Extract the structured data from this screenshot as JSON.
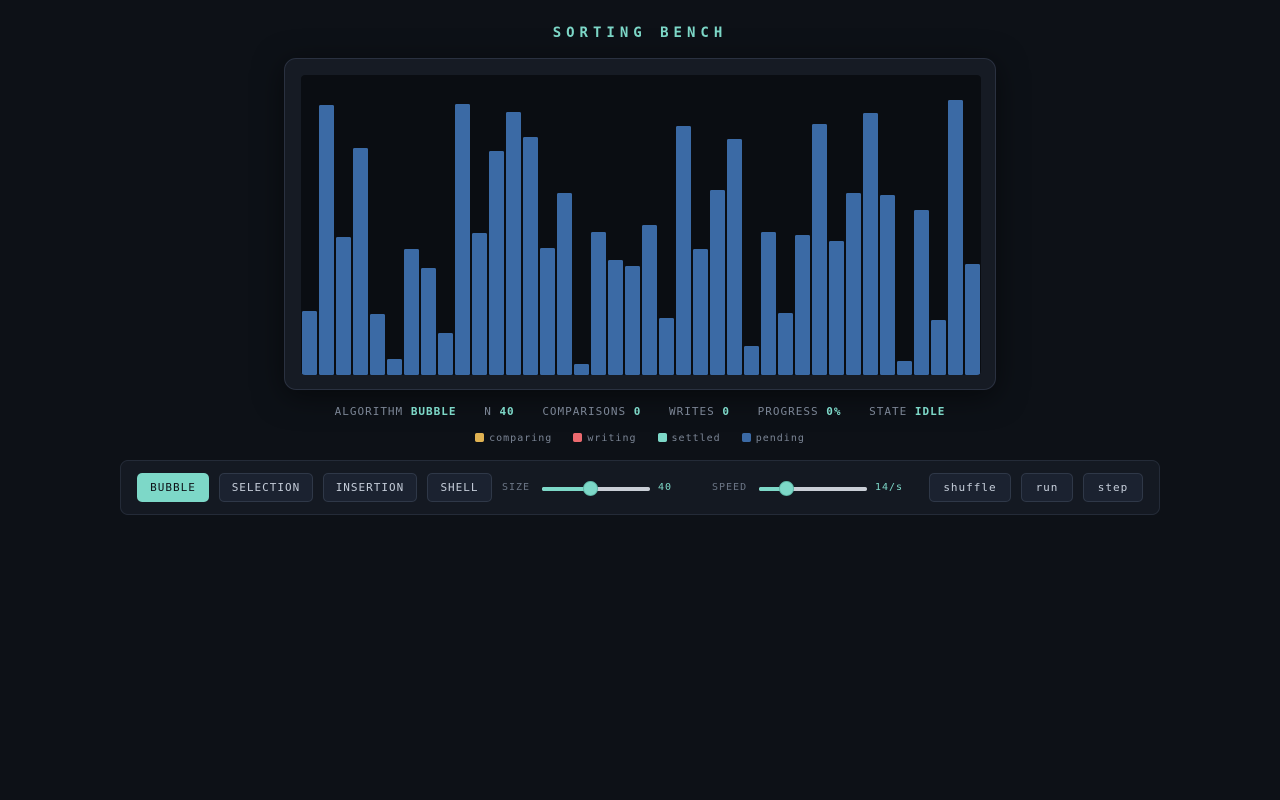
{
  "title": "SORTING BENCH",
  "stats": [
    {
      "label": "ALGORITHM",
      "value": "BUBBLE"
    },
    {
      "label": "N",
      "value": "40"
    },
    {
      "label": "COMPARISONS",
      "value": "0"
    },
    {
      "label": "WRITES",
      "value": "0"
    },
    {
      "label": "PROGRESS",
      "value": "0%"
    },
    {
      "label": "STATE",
      "value": "IDLE"
    }
  ],
  "legend": [
    {
      "label": "comparing",
      "color": "#e0b252"
    },
    {
      "label": "writing",
      "color": "#ec6a6f"
    },
    {
      "label": "settled",
      "color": "#7dd8c8"
    },
    {
      "label": "pending",
      "color": "#3b6aa5"
    }
  ],
  "array_values": [
    64,
    270,
    138,
    227,
    61,
    16,
    126,
    107,
    42,
    271,
    142,
    224,
    263,
    238,
    127,
    182,
    11,
    143,
    115,
    109,
    150,
    57,
    249,
    126,
    185,
    236,
    29,
    143,
    62,
    140,
    251,
    134,
    182,
    262,
    180,
    14,
    165,
    55,
    275,
    111
  ],
  "array_state": "pending",
  "algorithms": [
    {
      "label": "BUBBLE",
      "active": true
    },
    {
      "label": "SELECTION",
      "active": false
    },
    {
      "label": "INSERTION",
      "active": false
    },
    {
      "label": "SHELL",
      "active": false
    }
  ],
  "size": {
    "label": "SIZE",
    "value": "40",
    "level": 0.44
  },
  "speed": {
    "label": "SPEED",
    "value": "14/s",
    "level": 0.25
  },
  "actions": {
    "shuffle": "shuffle",
    "run": "run",
    "step": "step"
  },
  "colors": {
    "accent": "#7dd8c8",
    "bar": "#3b6aa5",
    "background": "#0d1117"
  }
}
